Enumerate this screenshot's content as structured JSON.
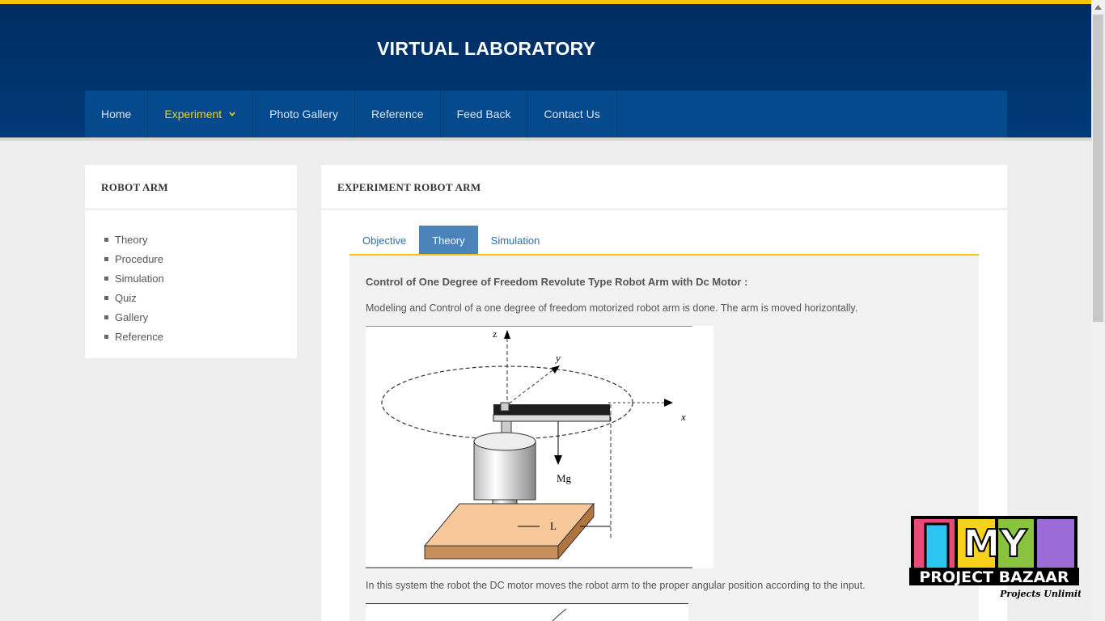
{
  "header": {
    "title": "VIRTUAL LABORATORY"
  },
  "nav": {
    "home": "Home",
    "experiment": "Experiment",
    "gallery": "Photo Gallery",
    "reference": "Reference",
    "feedback": "Feed Back",
    "contact": "Contact Us"
  },
  "sidebar": {
    "title": "ROBOT ARM",
    "items": [
      "Theory",
      "Procedure",
      "Simulation",
      "Quiz",
      "Gallery",
      "Reference"
    ]
  },
  "main": {
    "title": "EXPERIMENT ROBOT ARM",
    "tabs": [
      "Objective",
      "Theory",
      "Simulation"
    ],
    "active_tab": "Theory",
    "heading": "Control of One Degree of Freedom Revolute Type Robot Arm with Dc Motor :",
    "para1": "Modeling and Control of a one degree of freedom motorized robot arm is done. The arm is moved horizontally.",
    "para2": "In this system the robot the DC motor moves the robot arm to the proper angular position according to the input.",
    "figure_labels": {
      "z": "z",
      "y": "y",
      "x": "x",
      "mg": "Mg",
      "l": "L"
    }
  },
  "logo": {
    "line1": "MY",
    "line2": "PROJECT BAZAAR",
    "tagline": "Projects Unlimited"
  },
  "colors": {
    "accent": "#f5c400",
    "header": "#003a78",
    "nav": "#064a8e",
    "active_tab": "#4a84ba"
  }
}
